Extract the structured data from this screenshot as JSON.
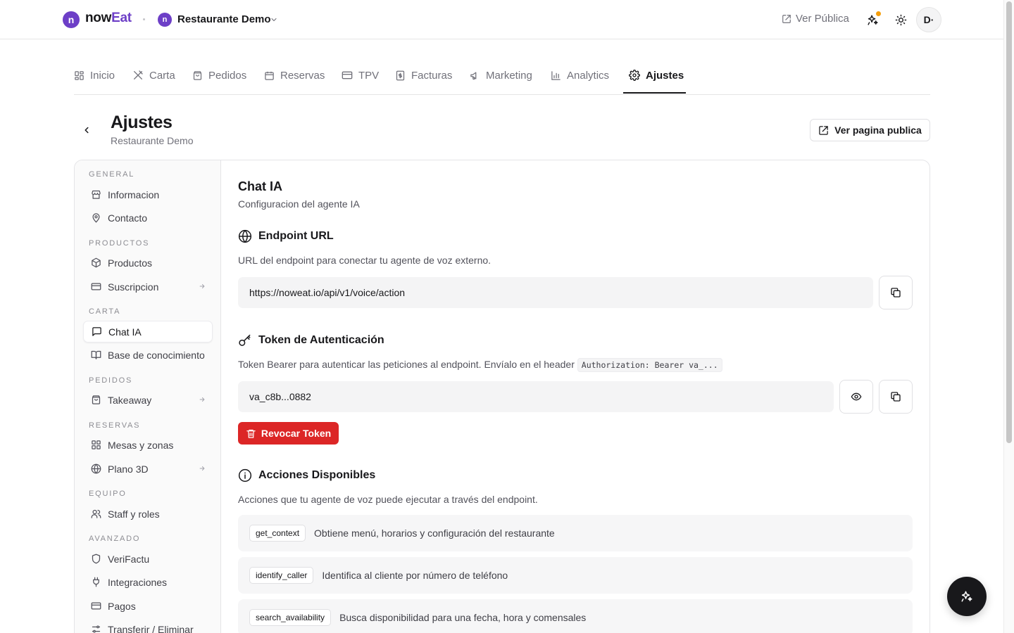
{
  "header": {
    "logo_letter": "n",
    "brand_now": "now",
    "brand_eat": "Eat",
    "restaurant_letter": "n",
    "restaurant_name": "Restaurante Demo",
    "public_link": "Ver Pública",
    "avatar_initials": "D·"
  },
  "tabs": [
    {
      "label": "Inicio",
      "icon": "grid-icon"
    },
    {
      "label": "Carta",
      "icon": "utensils-icon"
    },
    {
      "label": "Pedidos",
      "icon": "bag-icon"
    },
    {
      "label": "Reservas",
      "icon": "calendar-icon"
    },
    {
      "label": "TPV",
      "icon": "card-icon"
    },
    {
      "label": "Facturas",
      "icon": "receipt-icon"
    },
    {
      "label": "Marketing",
      "icon": "megaphone-icon"
    },
    {
      "label": "Analytics",
      "icon": "bar-chart-icon"
    },
    {
      "label": "Ajustes",
      "icon": "gear-icon",
      "active": true
    }
  ],
  "page": {
    "title": "Ajustes",
    "subtitle": "Restaurante Demo",
    "public_page_button": "Ver pagina publica"
  },
  "sidebar": {
    "groups": [
      {
        "label": "GENERAL",
        "items": [
          {
            "label": "Informacion"
          },
          {
            "label": "Contacto"
          }
        ]
      },
      {
        "label": "PRODUCTOS",
        "items": [
          {
            "label": "Productos"
          },
          {
            "label": "Suscripcion",
            "arrow": true
          }
        ]
      },
      {
        "label": "CARTA",
        "items": [
          {
            "label": "Chat IA",
            "active": true
          },
          {
            "label": "Base de conocimiento"
          }
        ]
      },
      {
        "label": "PEDIDOS",
        "items": [
          {
            "label": "Takeaway",
            "arrow": true
          }
        ]
      },
      {
        "label": "RESERVAS",
        "items": [
          {
            "label": "Mesas y zonas"
          },
          {
            "label": "Plano 3D",
            "arrow": true
          }
        ]
      },
      {
        "label": "EQUIPO",
        "items": [
          {
            "label": "Staff y roles"
          }
        ]
      },
      {
        "label": "AVANZADO",
        "items": [
          {
            "label": "VeriFactu"
          },
          {
            "label": "Integraciones"
          },
          {
            "label": "Pagos"
          },
          {
            "label": "Transferir / Eliminar"
          }
        ]
      }
    ]
  },
  "main": {
    "title": "Chat IA",
    "subtitle": "Configuracion del agente IA",
    "endpoint": {
      "heading": "Endpoint URL",
      "description": "URL del endpoint para conectar tu agente de voz externo.",
      "value": "https://noweat.io/api/v1/voice/action"
    },
    "token": {
      "heading": "Token de Autenticación",
      "description": "Token Bearer para autenticar las peticiones al endpoint. Envíalo en el header",
      "header_code": "Authorization: Bearer va_...",
      "value": "va_c8b...0882",
      "revoke_label": "Revocar Token"
    },
    "actions": {
      "heading": "Acciones Disponibles",
      "description": "Acciones que tu agente de voz puede ejecutar a través del endpoint.",
      "items": [
        {
          "code": "get_context",
          "text": "Obtiene menú, horarios y configuración del restaurante"
        },
        {
          "code": "identify_caller",
          "text": "Identifica al cliente por número de teléfono"
        },
        {
          "code": "search_availability",
          "text": "Busca disponibilidad para una fecha, hora y comensales"
        }
      ]
    }
  },
  "colors": {
    "brand": "#6d3fc7",
    "danger": "#dc2626",
    "notification": "#f59e0b"
  }
}
